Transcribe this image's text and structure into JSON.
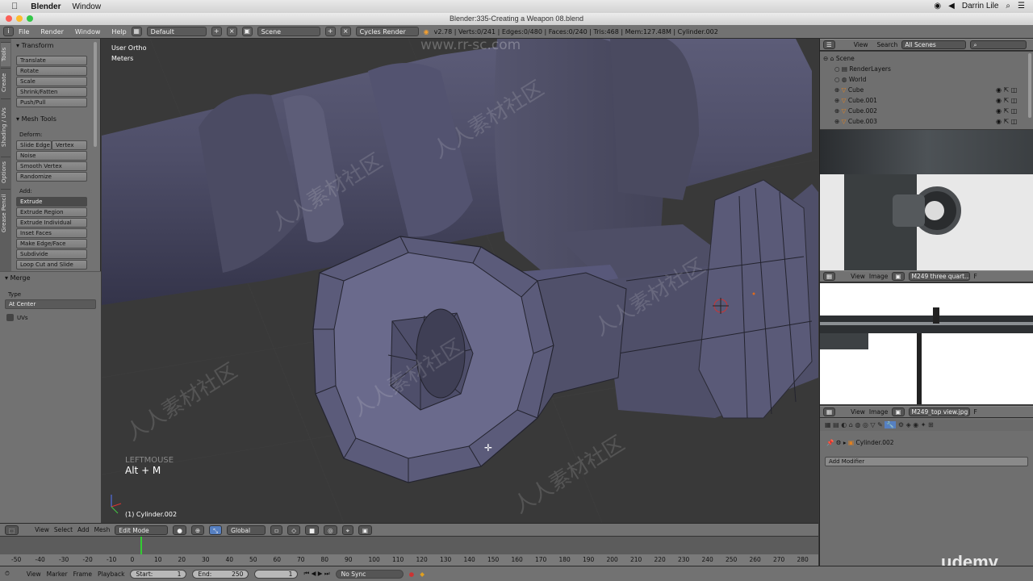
{
  "mac_menu": {
    "app": "Blender",
    "items": [
      "Window"
    ],
    "user": "Darrin Lile"
  },
  "window_title": "Blender:335-Creating a Weapon 08.blend",
  "info_header": {
    "menus": [
      "File",
      "Render",
      "Window",
      "Help"
    ],
    "layout": "Default",
    "scene": "Scene",
    "engine": "Cycles Render",
    "stats": "v2.78 | Verts:0/241 | Edges:0/480 | Faces:0/240 | Tris:468 | Mem:127.48M | Cylinder.002"
  },
  "tool_tabs": [
    "Tools",
    "Create",
    "Shading / UVs",
    "Options",
    "Grease Pencil"
  ],
  "transform": {
    "title": "Transform",
    "buttons": [
      "Translate",
      "Rotate",
      "Scale",
      "Shrink/Fatten",
      "Push/Pull"
    ]
  },
  "mesh_tools": {
    "title": "Mesh Tools",
    "deform_label": "Deform:",
    "slide_edge": "Slide Edge",
    "vertex": "Vertex",
    "deform_buttons": [
      "Noise",
      "Smooth Vertex",
      "Randomize"
    ],
    "add_label": "Add:",
    "extrude": "Extrude",
    "add_buttons": [
      "Extrude Region",
      "Extrude Individual",
      "Inset Faces",
      "Make Edge/Face",
      "Subdivide",
      "Loop Cut and Slide"
    ]
  },
  "merge_panel": {
    "title": "Merge",
    "type_label": "Type",
    "type_value": "At Center",
    "uvs_label": "UVs"
  },
  "viewport": {
    "view_name": "User Ortho",
    "units": "Meters",
    "last_input": "LEFTMOUSE",
    "hotkey": "Alt + M",
    "object_label": "(1) Cylinder.002"
  },
  "outliner": {
    "view_menu": "View",
    "search_menu": "Search",
    "filter": "All Scenes",
    "rows": [
      "Scene",
      "RenderLayers",
      "World",
      "Cube",
      "Cube.001",
      "Cube.002",
      "Cube.003"
    ]
  },
  "image_editor_1": {
    "view": "View",
    "image": "Image",
    "name": "M249 three quart...",
    "f": "F"
  },
  "image_editor_2": {
    "view": "View",
    "image": "Image",
    "name": "M249_top view.jpg",
    "f": "F"
  },
  "properties": {
    "object": "Cylinder.002",
    "add_modifier": "Add Modifier"
  },
  "view3d_header": {
    "menus": [
      "View",
      "Select",
      "Add",
      "Mesh"
    ],
    "mode": "Edit Mode",
    "orientation": "Global"
  },
  "timeline": {
    "ticks": [
      "-50",
      "-40",
      "-30",
      "-20",
      "-10",
      "0",
      "10",
      "20",
      "30",
      "40",
      "50",
      "60",
      "70",
      "80",
      "90",
      "100",
      "110",
      "120",
      "130",
      "140",
      "150",
      "160",
      "170",
      "180",
      "190",
      "200",
      "210",
      "220",
      "230",
      "240",
      "250",
      "260",
      "270",
      "280"
    ],
    "menus": [
      "View",
      "Marker",
      "Frame",
      "Playback"
    ],
    "start_label": "Start:",
    "start_value": "1",
    "end_label": "End:",
    "end_value": "250",
    "current": "1",
    "sync": "No Sync"
  },
  "branding": {
    "udemy": "udemy",
    "watermark": "人人素材社区",
    "site": "www.rr-sc.com"
  },
  "colors": {
    "mesh": "#5e5e7a",
    "edit_mode_accent": "#5680c2",
    "selection": "#e06a1a"
  }
}
